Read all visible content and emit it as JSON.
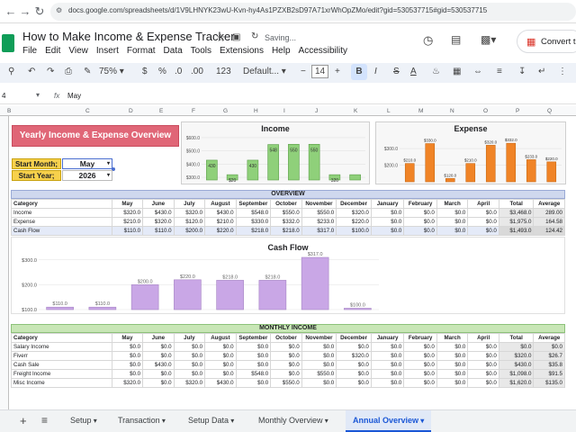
{
  "browser": {
    "url": "docs.google.com/spreadsheets/d/1V9LHNYK23wU-Kvn-hy4As1PZXB2sD97A71xrWhOpZMo/edit?gid=530537715#gid=530537715"
  },
  "app": {
    "title": "How to Make Income & Expense Tracker",
    "status": "Saving...",
    "convert_label": "Convert t",
    "menu": [
      "File",
      "Edit",
      "View",
      "Insert",
      "Format",
      "Data",
      "Tools",
      "Extensions",
      "Help",
      "Accessibility"
    ]
  },
  "toolbar": {
    "zoom": "75%",
    "currency": "$",
    "percent": "%",
    "dec_less": ".0",
    "dec_more": ".00",
    "more_formats": "123",
    "font": "Default...",
    "font_size": "14",
    "bold": "B",
    "italic": "I",
    "strike": "S",
    "color": "A"
  },
  "formula": {
    "cell_ref": "4",
    "fx": "fx",
    "content": "May"
  },
  "columns": [
    "B",
    "C",
    "D",
    "E",
    "F",
    "G",
    "H",
    "I",
    "J",
    "K",
    "L",
    "M",
    "N",
    "O",
    "P",
    "Q"
  ],
  "dashboard": {
    "title": "Yearly Income & Expense Overview",
    "start_month_label": "Start Month;",
    "start_month_value": "May",
    "start_year_label": "Start Year;",
    "start_year_value": "2026"
  },
  "overview": {
    "title": "OVERVIEW",
    "header": [
      "Category",
      "May",
      "June",
      "July",
      "August",
      "September",
      "October",
      "November",
      "December",
      "January",
      "February",
      "March",
      "April",
      "Total",
      "Average"
    ],
    "rows": [
      [
        "Income",
        "$320.0",
        "$430.0",
        "$320.0",
        "$430.0",
        "$548.0",
        "$550.0",
        "$550.0",
        "$320.0",
        "$0.0",
        "$0.0",
        "$0.0",
        "$0.0",
        "$3,468.0",
        "289.00"
      ],
      [
        "Expense",
        "$210.0",
        "$320.0",
        "$120.0",
        "$210.0",
        "$330.0",
        "$332.0",
        "$233.0",
        "$220.0",
        "$0.0",
        "$0.0",
        "$0.0",
        "$0.0",
        "$1,975.0",
        "164.58"
      ],
      [
        "Cash Flow",
        "$110.0",
        "$110.0",
        "$200.0",
        "$220.0",
        "$218.0",
        "$218.0",
        "$317.0",
        "$100.0",
        "$0.0",
        "$0.0",
        "$0.0",
        "$0.0",
        "$1,493.0",
        "124.42"
      ]
    ]
  },
  "monthly_income": {
    "title": "MONTHLY INCOME",
    "header": [
      "Category",
      "May",
      "June",
      "July",
      "August",
      "September",
      "October",
      "November",
      "December",
      "January",
      "February",
      "March",
      "April",
      "Total",
      "Average"
    ],
    "rows": [
      [
        "Salary Income",
        "$0.0",
        "$0.0",
        "$0.0",
        "$0.0",
        "$0.0",
        "$0.0",
        "$0.0",
        "$0.0",
        "$0.0",
        "$0.0",
        "$0.0",
        "$0.0",
        "$0.0",
        "$0.0"
      ],
      [
        "Fiverr",
        "$0.0",
        "$0.0",
        "$0.0",
        "$0.0",
        "$0.0",
        "$0.0",
        "$0.0",
        "$320.0",
        "$0.0",
        "$0.0",
        "$0.0",
        "$0.0",
        "$320.0",
        "$26.7"
      ],
      [
        "Cash Sale",
        "$0.0",
        "$430.0",
        "$0.0",
        "$0.0",
        "$0.0",
        "$0.0",
        "$0.0",
        "$0.0",
        "$0.0",
        "$0.0",
        "$0.0",
        "$0.0",
        "$430.0",
        "$35.8"
      ],
      [
        "Freight Income",
        "$0.0",
        "$0.0",
        "$0.0",
        "$0.0",
        "$548.0",
        "$0.0",
        "$550.0",
        "$0.0",
        "$0.0",
        "$0.0",
        "$0.0",
        "$0.0",
        "$1,098.0",
        "$91.5"
      ],
      [
        "Misc Income",
        "$320.0",
        "$0.0",
        "$320.0",
        "$430.0",
        "$0.0",
        "$550.0",
        "$0.0",
        "$0.0",
        "$0.0",
        "$0.0",
        "$0.0",
        "$0.0",
        "$1,620.0",
        "$135.0"
      ]
    ]
  },
  "tabs": {
    "add": "+",
    "list": "≡",
    "items": [
      "Setup",
      "Transaction",
      "Setup Data",
      "Monthly Overview",
      "Annual Overview"
    ],
    "active": "Annual Overview"
  },
  "chart_data": [
    {
      "type": "bar",
      "title": "Income",
      "categories": [
        "May",
        "June",
        "July",
        "August",
        "September",
        "October",
        "November",
        "December"
      ],
      "values": [
        430,
        320,
        430,
        548,
        550,
        550,
        320,
        320
      ],
      "labels": [
        "430",
        "$20",
        "430",
        "548",
        "550",
        "550",
        "320",
        ""
      ],
      "yticks": [
        "$600.0",
        "$500.0",
        "$400.0",
        "$300.0"
      ],
      "ylim": [
        280,
        620
      ],
      "color": "#8fd07a"
    },
    {
      "type": "bar",
      "title": "Expense",
      "categories": [
        "May",
        "June",
        "July",
        "August",
        "September",
        "October",
        "November",
        "December"
      ],
      "values": [
        210,
        330,
        120,
        210,
        320,
        332,
        233,
        220
      ],
      "labels": [
        "$210.0",
        "$330.0",
        "$120.0",
        "$210.0",
        "$320.0",
        "$332.0",
        "$233.0",
        "$220.0"
      ],
      "yticks": [
        "$300.0",
        "$200.0"
      ],
      "ylim": [
        100,
        360
      ],
      "color": "#f08427"
    },
    {
      "type": "bar",
      "title": "Cash Flow",
      "categories": [
        "May",
        "June",
        "July",
        "August",
        "September",
        "October",
        "November",
        "December"
      ],
      "values": [
        110,
        110,
        200,
        220,
        218,
        218,
        317,
        100
      ],
      "labels": [
        "$110.0",
        "$110.0",
        "$200.0",
        "$220.0",
        "$218.0",
        "$218.0",
        "$317.0",
        "$100.0"
      ],
      "yticks": [
        "$300.0",
        "$200.0",
        "$100.0"
      ],
      "ylim": [
        100,
        310
      ],
      "color": "#c9a7e6"
    }
  ]
}
